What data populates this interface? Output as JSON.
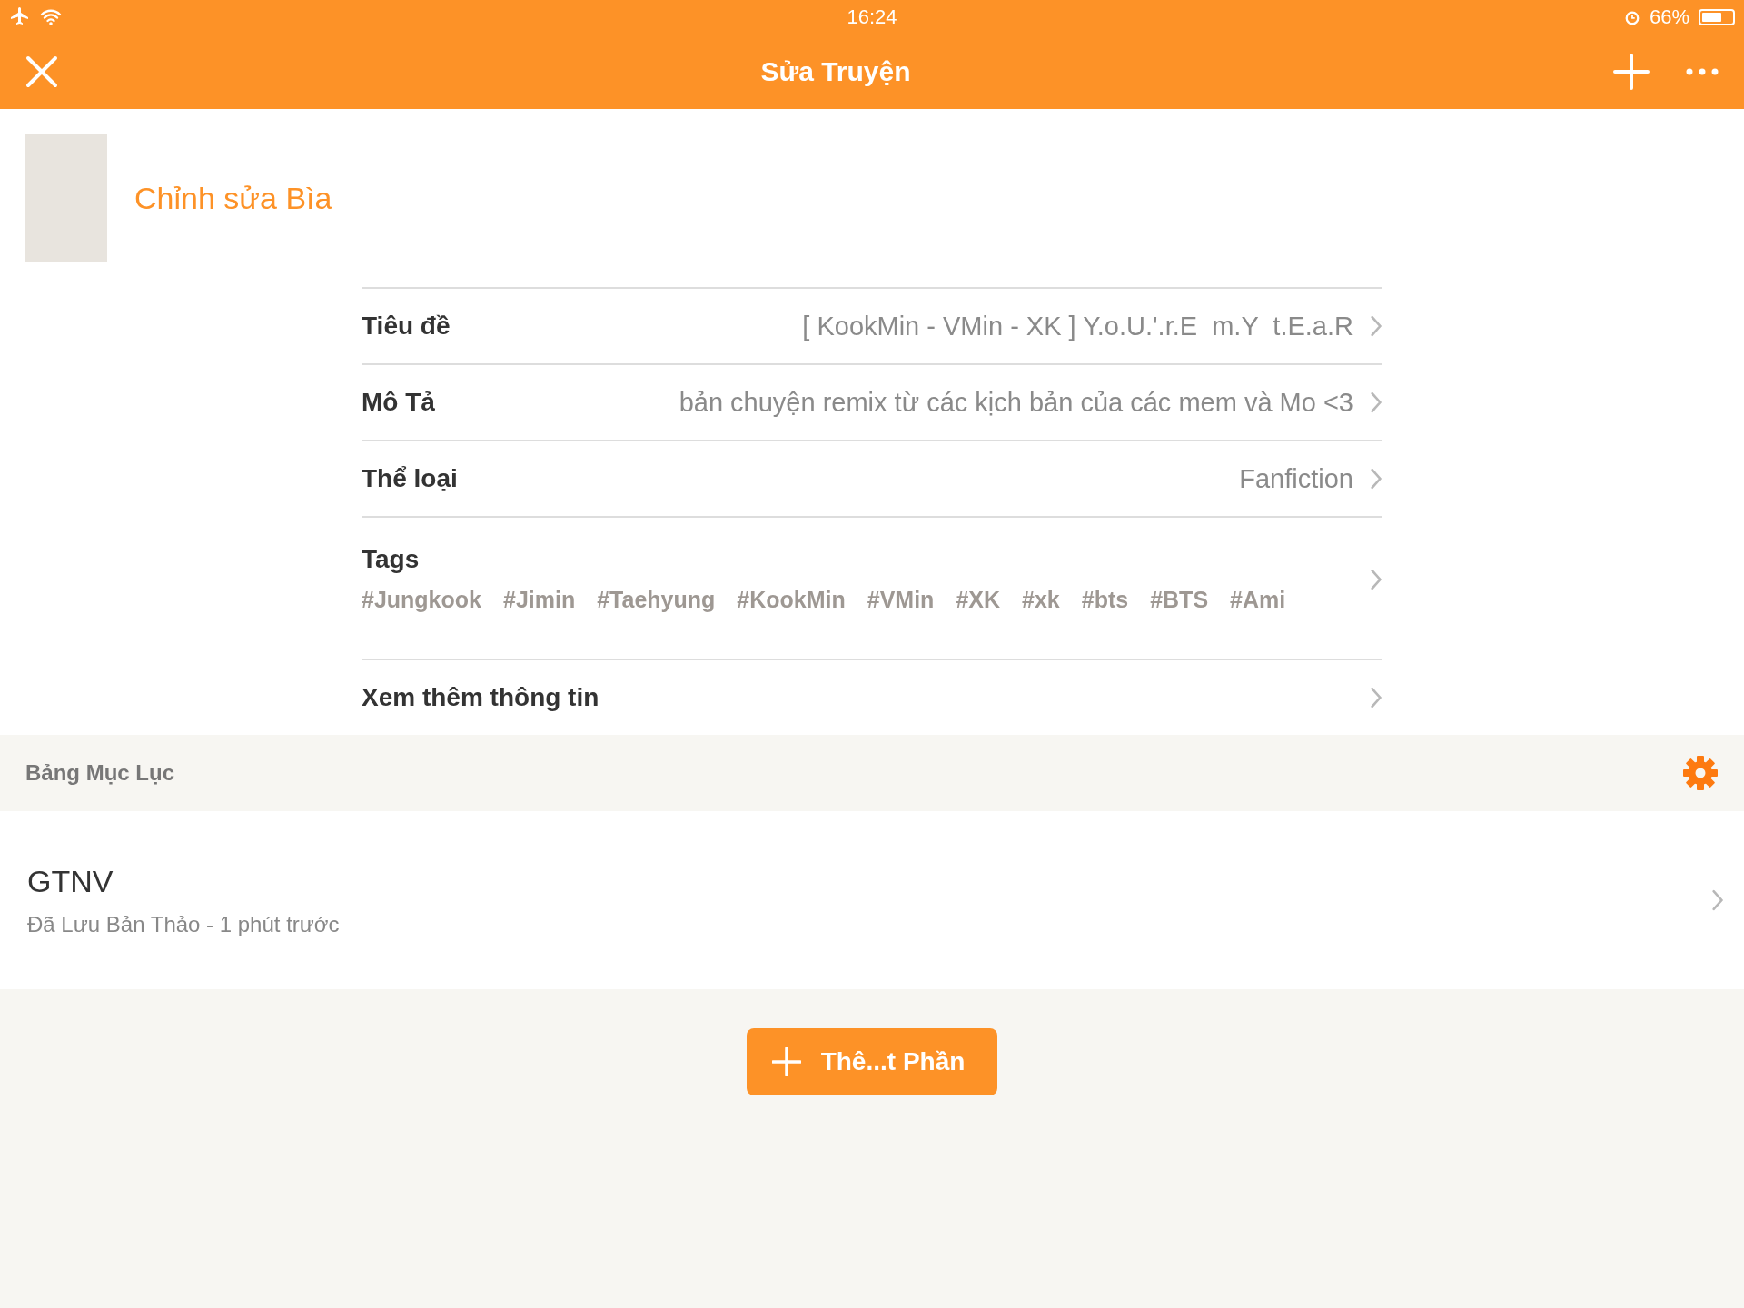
{
  "status_bar": {
    "time": "16:24",
    "battery_percent": "66%",
    "battery": {
      "level": 0.66
    }
  },
  "nav_bar": {
    "title": "Sửa Truyện"
  },
  "cover": {
    "edit_label": "Chỉnh sửa Bìa"
  },
  "fields": [
    {
      "kind": "value",
      "label": "Tiêu đề",
      "value": "[ KookMin - VMin - XK ] Y.o.U.'.r.E  m.Y  t.E.a.R"
    },
    {
      "kind": "value",
      "label": "Mô Tả",
      "value": "bản chuyện remix từ các kịch bản của các mem và Mo <3"
    },
    {
      "kind": "value",
      "label": "Thể loại",
      "value": "Fanfiction"
    },
    {
      "kind": "tags",
      "label": "Tags",
      "tags": [
        "#Jungkook",
        "#Jimin",
        "#Taehyung",
        "#KookMin",
        "#VMin",
        "#XK",
        "#xk",
        "#bts",
        "#BTS",
        "#Ami"
      ]
    },
    {
      "kind": "link",
      "label": "Xem thêm thông tin"
    }
  ],
  "toc": {
    "title": "Bảng Mục Lục",
    "parts": [
      {
        "title": "GTNV",
        "status": "Đã Lưu Bản Thảo - 1 phút trước"
      }
    ]
  },
  "add_button": {
    "label": "Thê...t Phần"
  }
}
